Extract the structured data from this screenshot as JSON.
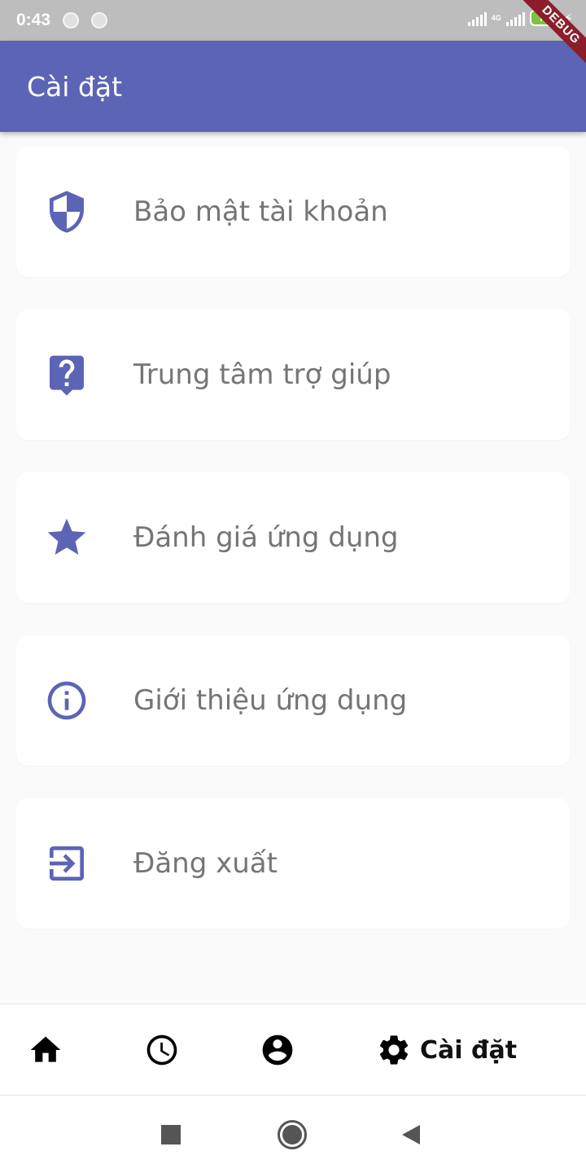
{
  "status_bar": {
    "time": "0:43",
    "network": "4G",
    "battery": "77"
  },
  "debug_banner": "DEBUG",
  "app_bar": {
    "title": "Cài đặt"
  },
  "settings": {
    "items": [
      {
        "label": "Bảo mật tài khoản",
        "icon": "shield-icon"
      },
      {
        "label": "Trung tâm trợ giúp",
        "icon": "help-icon"
      },
      {
        "label": "Đánh giá ứng dụng",
        "icon": "star-icon"
      },
      {
        "label": "Giới thiệu ứng dụng",
        "icon": "info-icon"
      },
      {
        "label": "Đăng xuất",
        "icon": "logout-icon"
      }
    ]
  },
  "bottom_nav": {
    "items": [
      {
        "icon": "home-icon"
      },
      {
        "icon": "history-icon"
      },
      {
        "icon": "account-icon"
      },
      {
        "icon": "gear-icon",
        "label": "Cài đặt",
        "active": true
      }
    ]
  },
  "colors": {
    "primary": "#5c64b6",
    "status_bar": "#bdbdbd",
    "label": "#757575",
    "background": "#fafafa"
  }
}
